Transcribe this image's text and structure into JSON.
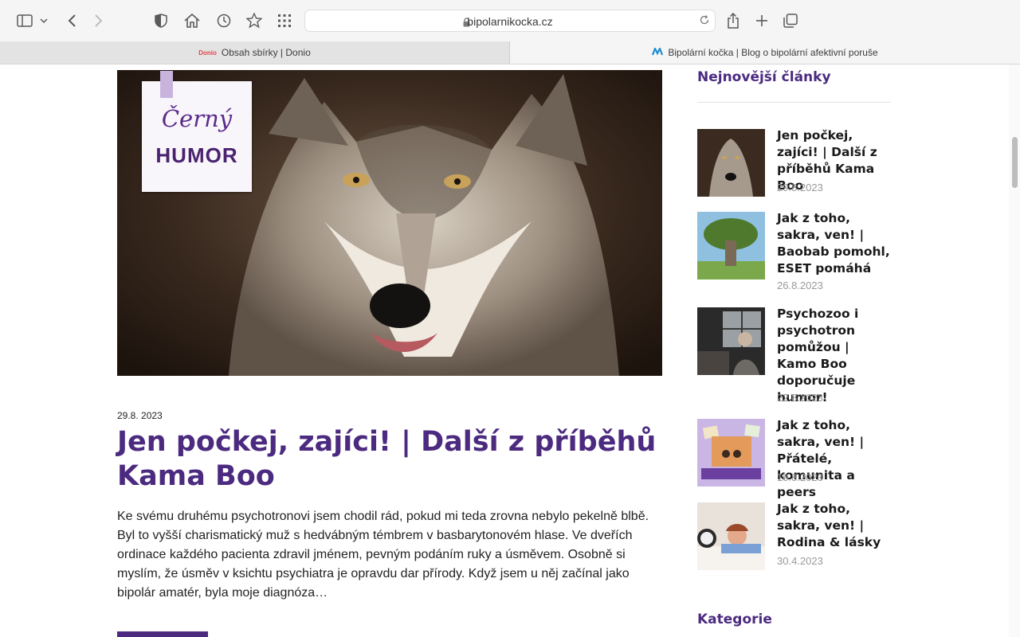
{
  "browser": {
    "url": "bipolarnikocka.cz",
    "tabs": [
      {
        "label": "Obsah sbírky | Donio",
        "favicon": "Donio"
      },
      {
        "label": "Bipolární kočka | Blog o bipolární afektivní poruše",
        "favicon": "bk-logo-icon"
      }
    ]
  },
  "hero": {
    "badge_line1": "Černý",
    "badge_line2": "HUMOR"
  },
  "article": {
    "date": "29.8. 2023",
    "title": "Jen počkej, zajíci! | Další z příběhů Kama Boo",
    "excerpt": "Ke svému druhému psychotronovi jsem chodil rád, pokud mi teda zrovna nebylo pekelně blbě. Byl to vyšší charismatický muž s hedvábným témbrem v basbarytonovém hlase. Ve dveřích ordinace každého pacienta zdravil jménem, pevným podáním ruky a úsměvem. Osobně si myslím, že úsměv v ksichtu psychiatra je opravdu dar přírody. Když jsem u něj začínal jako bipolár amatér, byla moje diagnóza…"
  },
  "sidebar": {
    "latest_heading": "Nejnovější články",
    "posts": [
      {
        "title": "Jen počkej, zajíci! | Další z příběhů Kama Boo",
        "date": "29.8.2023"
      },
      {
        "title": "Jak z toho, sakra, ven! | Baobab pomohl, ESET pomáhá",
        "date": "26.8.2023"
      },
      {
        "title": "Psychozoo i psychotron pomůžou | Kamo Boo doporučuje humor!",
        "date": "22.8.2023"
      },
      {
        "title": "Jak z toho, sakra, ven! | Přátelé, komunita a peers",
        "date": "18.8.2023"
      },
      {
        "title": "Jak z toho, sakra, ven! | Rodina & lásky",
        "date": "30.4.2023"
      }
    ],
    "categories_heading": "Kategorie"
  },
  "colors": {
    "accent": "#4b2a80",
    "date_gray": "#999999"
  }
}
